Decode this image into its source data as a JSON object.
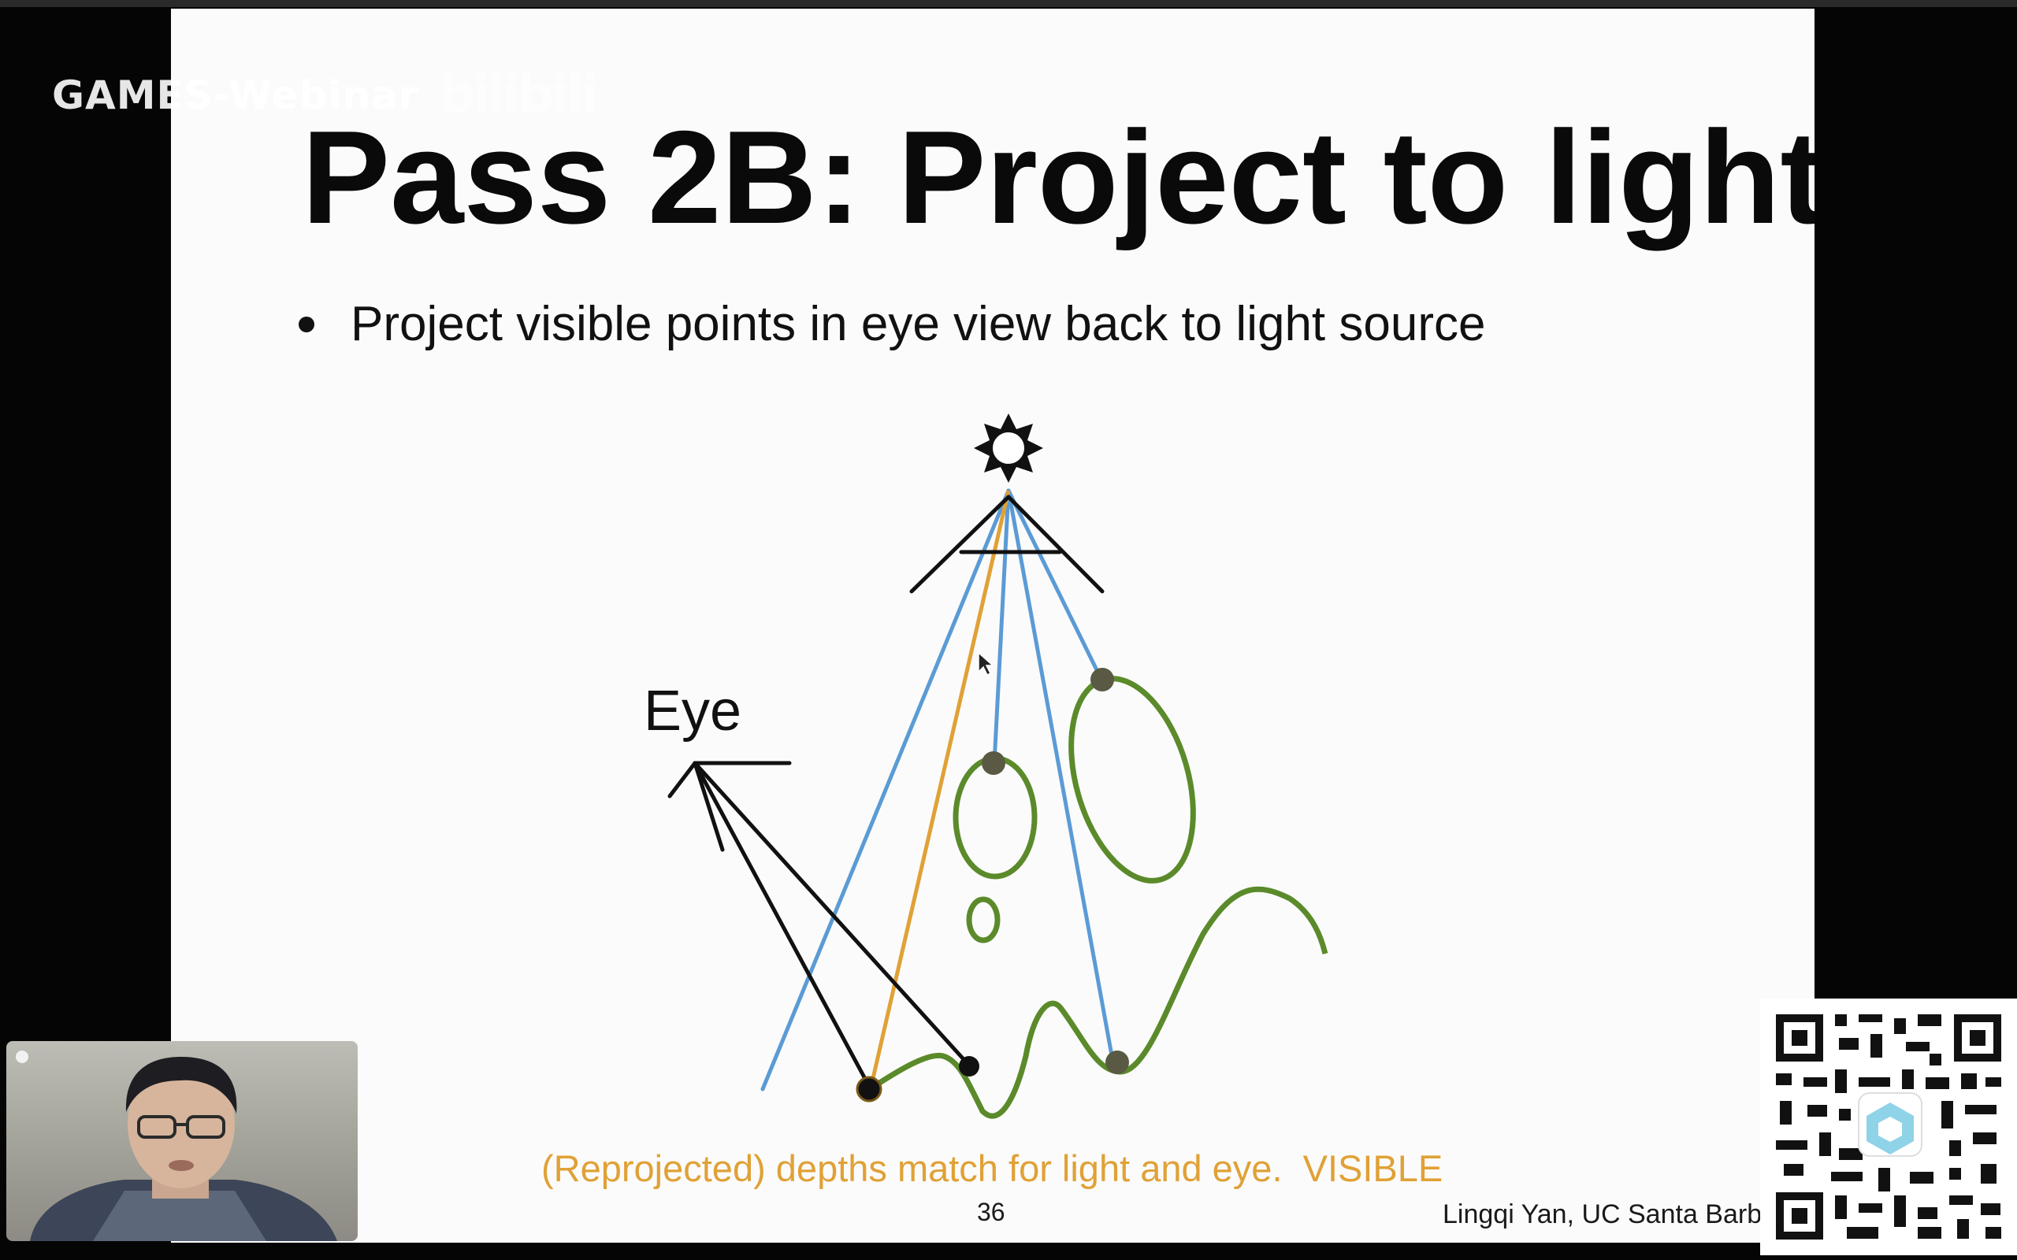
{
  "slide": {
    "title": "Pass 2B: Project to light",
    "bullet": "Project visible points in eye view back to light source",
    "eye_label": "Eye",
    "caption": "(Reprojected) depths match for light and eye.  VISIBLE",
    "page_number": "36",
    "author": "Lingqi Yan, UC Santa Barba"
  },
  "overlay": {
    "watermark_text": "GAMES-Webinar",
    "watermark_logo": "bilibili"
  },
  "colors": {
    "slide_bg": "#fbfbfb",
    "title": "#0a0a0a",
    "light_rays": "#5b9bd5",
    "eye_ray": "#e0a136",
    "geometry": "#5b8a2b",
    "caption": "#e0a136"
  },
  "icons": {
    "light": "sun-icon",
    "cursor": "mouse-pointer-icon",
    "qr": "qr-code-icon",
    "webcam": "presenter-webcam"
  }
}
